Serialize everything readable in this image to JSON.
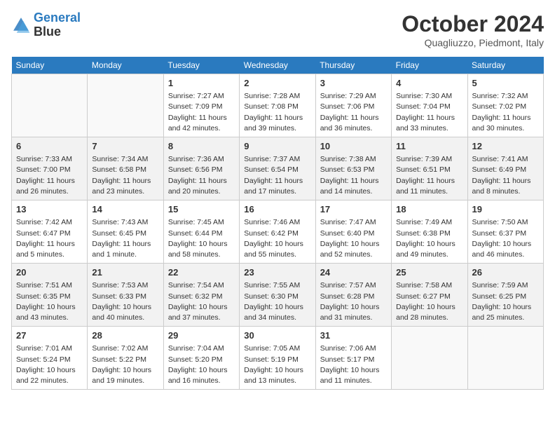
{
  "header": {
    "logo_line1": "General",
    "logo_line2": "Blue",
    "month": "October 2024",
    "location": "Quagliuzzo, Piedmont, Italy"
  },
  "weekdays": [
    "Sunday",
    "Monday",
    "Tuesday",
    "Wednesday",
    "Thursday",
    "Friday",
    "Saturday"
  ],
  "weeks": [
    [
      {
        "day": "",
        "info": ""
      },
      {
        "day": "",
        "info": ""
      },
      {
        "day": "1",
        "info": "Sunrise: 7:27 AM\nSunset: 7:09 PM\nDaylight: 11 hours\nand 42 minutes."
      },
      {
        "day": "2",
        "info": "Sunrise: 7:28 AM\nSunset: 7:08 PM\nDaylight: 11 hours\nand 39 minutes."
      },
      {
        "day": "3",
        "info": "Sunrise: 7:29 AM\nSunset: 7:06 PM\nDaylight: 11 hours\nand 36 minutes."
      },
      {
        "day": "4",
        "info": "Sunrise: 7:30 AM\nSunset: 7:04 PM\nDaylight: 11 hours\nand 33 minutes."
      },
      {
        "day": "5",
        "info": "Sunrise: 7:32 AM\nSunset: 7:02 PM\nDaylight: 11 hours\nand 30 minutes."
      }
    ],
    [
      {
        "day": "6",
        "info": "Sunrise: 7:33 AM\nSunset: 7:00 PM\nDaylight: 11 hours\nand 26 minutes."
      },
      {
        "day": "7",
        "info": "Sunrise: 7:34 AM\nSunset: 6:58 PM\nDaylight: 11 hours\nand 23 minutes."
      },
      {
        "day": "8",
        "info": "Sunrise: 7:36 AM\nSunset: 6:56 PM\nDaylight: 11 hours\nand 20 minutes."
      },
      {
        "day": "9",
        "info": "Sunrise: 7:37 AM\nSunset: 6:54 PM\nDaylight: 11 hours\nand 17 minutes."
      },
      {
        "day": "10",
        "info": "Sunrise: 7:38 AM\nSunset: 6:53 PM\nDaylight: 11 hours\nand 14 minutes."
      },
      {
        "day": "11",
        "info": "Sunrise: 7:39 AM\nSunset: 6:51 PM\nDaylight: 11 hours\nand 11 minutes."
      },
      {
        "day": "12",
        "info": "Sunrise: 7:41 AM\nSunset: 6:49 PM\nDaylight: 11 hours\nand 8 minutes."
      }
    ],
    [
      {
        "day": "13",
        "info": "Sunrise: 7:42 AM\nSunset: 6:47 PM\nDaylight: 11 hours\nand 5 minutes."
      },
      {
        "day": "14",
        "info": "Sunrise: 7:43 AM\nSunset: 6:45 PM\nDaylight: 11 hours\nand 1 minute."
      },
      {
        "day": "15",
        "info": "Sunrise: 7:45 AM\nSunset: 6:44 PM\nDaylight: 10 hours\nand 58 minutes."
      },
      {
        "day": "16",
        "info": "Sunrise: 7:46 AM\nSunset: 6:42 PM\nDaylight: 10 hours\nand 55 minutes."
      },
      {
        "day": "17",
        "info": "Sunrise: 7:47 AM\nSunset: 6:40 PM\nDaylight: 10 hours\nand 52 minutes."
      },
      {
        "day": "18",
        "info": "Sunrise: 7:49 AM\nSunset: 6:38 PM\nDaylight: 10 hours\nand 49 minutes."
      },
      {
        "day": "19",
        "info": "Sunrise: 7:50 AM\nSunset: 6:37 PM\nDaylight: 10 hours\nand 46 minutes."
      }
    ],
    [
      {
        "day": "20",
        "info": "Sunrise: 7:51 AM\nSunset: 6:35 PM\nDaylight: 10 hours\nand 43 minutes."
      },
      {
        "day": "21",
        "info": "Sunrise: 7:53 AM\nSunset: 6:33 PM\nDaylight: 10 hours\nand 40 minutes."
      },
      {
        "day": "22",
        "info": "Sunrise: 7:54 AM\nSunset: 6:32 PM\nDaylight: 10 hours\nand 37 minutes."
      },
      {
        "day": "23",
        "info": "Sunrise: 7:55 AM\nSunset: 6:30 PM\nDaylight: 10 hours\nand 34 minutes."
      },
      {
        "day": "24",
        "info": "Sunrise: 7:57 AM\nSunset: 6:28 PM\nDaylight: 10 hours\nand 31 minutes."
      },
      {
        "day": "25",
        "info": "Sunrise: 7:58 AM\nSunset: 6:27 PM\nDaylight: 10 hours\nand 28 minutes."
      },
      {
        "day": "26",
        "info": "Sunrise: 7:59 AM\nSunset: 6:25 PM\nDaylight: 10 hours\nand 25 minutes."
      }
    ],
    [
      {
        "day": "27",
        "info": "Sunrise: 7:01 AM\nSunset: 5:24 PM\nDaylight: 10 hours\nand 22 minutes."
      },
      {
        "day": "28",
        "info": "Sunrise: 7:02 AM\nSunset: 5:22 PM\nDaylight: 10 hours\nand 19 minutes."
      },
      {
        "day": "29",
        "info": "Sunrise: 7:04 AM\nSunset: 5:20 PM\nDaylight: 10 hours\nand 16 minutes."
      },
      {
        "day": "30",
        "info": "Sunrise: 7:05 AM\nSunset: 5:19 PM\nDaylight: 10 hours\nand 13 minutes."
      },
      {
        "day": "31",
        "info": "Sunrise: 7:06 AM\nSunset: 5:17 PM\nDaylight: 10 hours\nand 11 minutes."
      },
      {
        "day": "",
        "info": ""
      },
      {
        "day": "",
        "info": ""
      }
    ]
  ]
}
